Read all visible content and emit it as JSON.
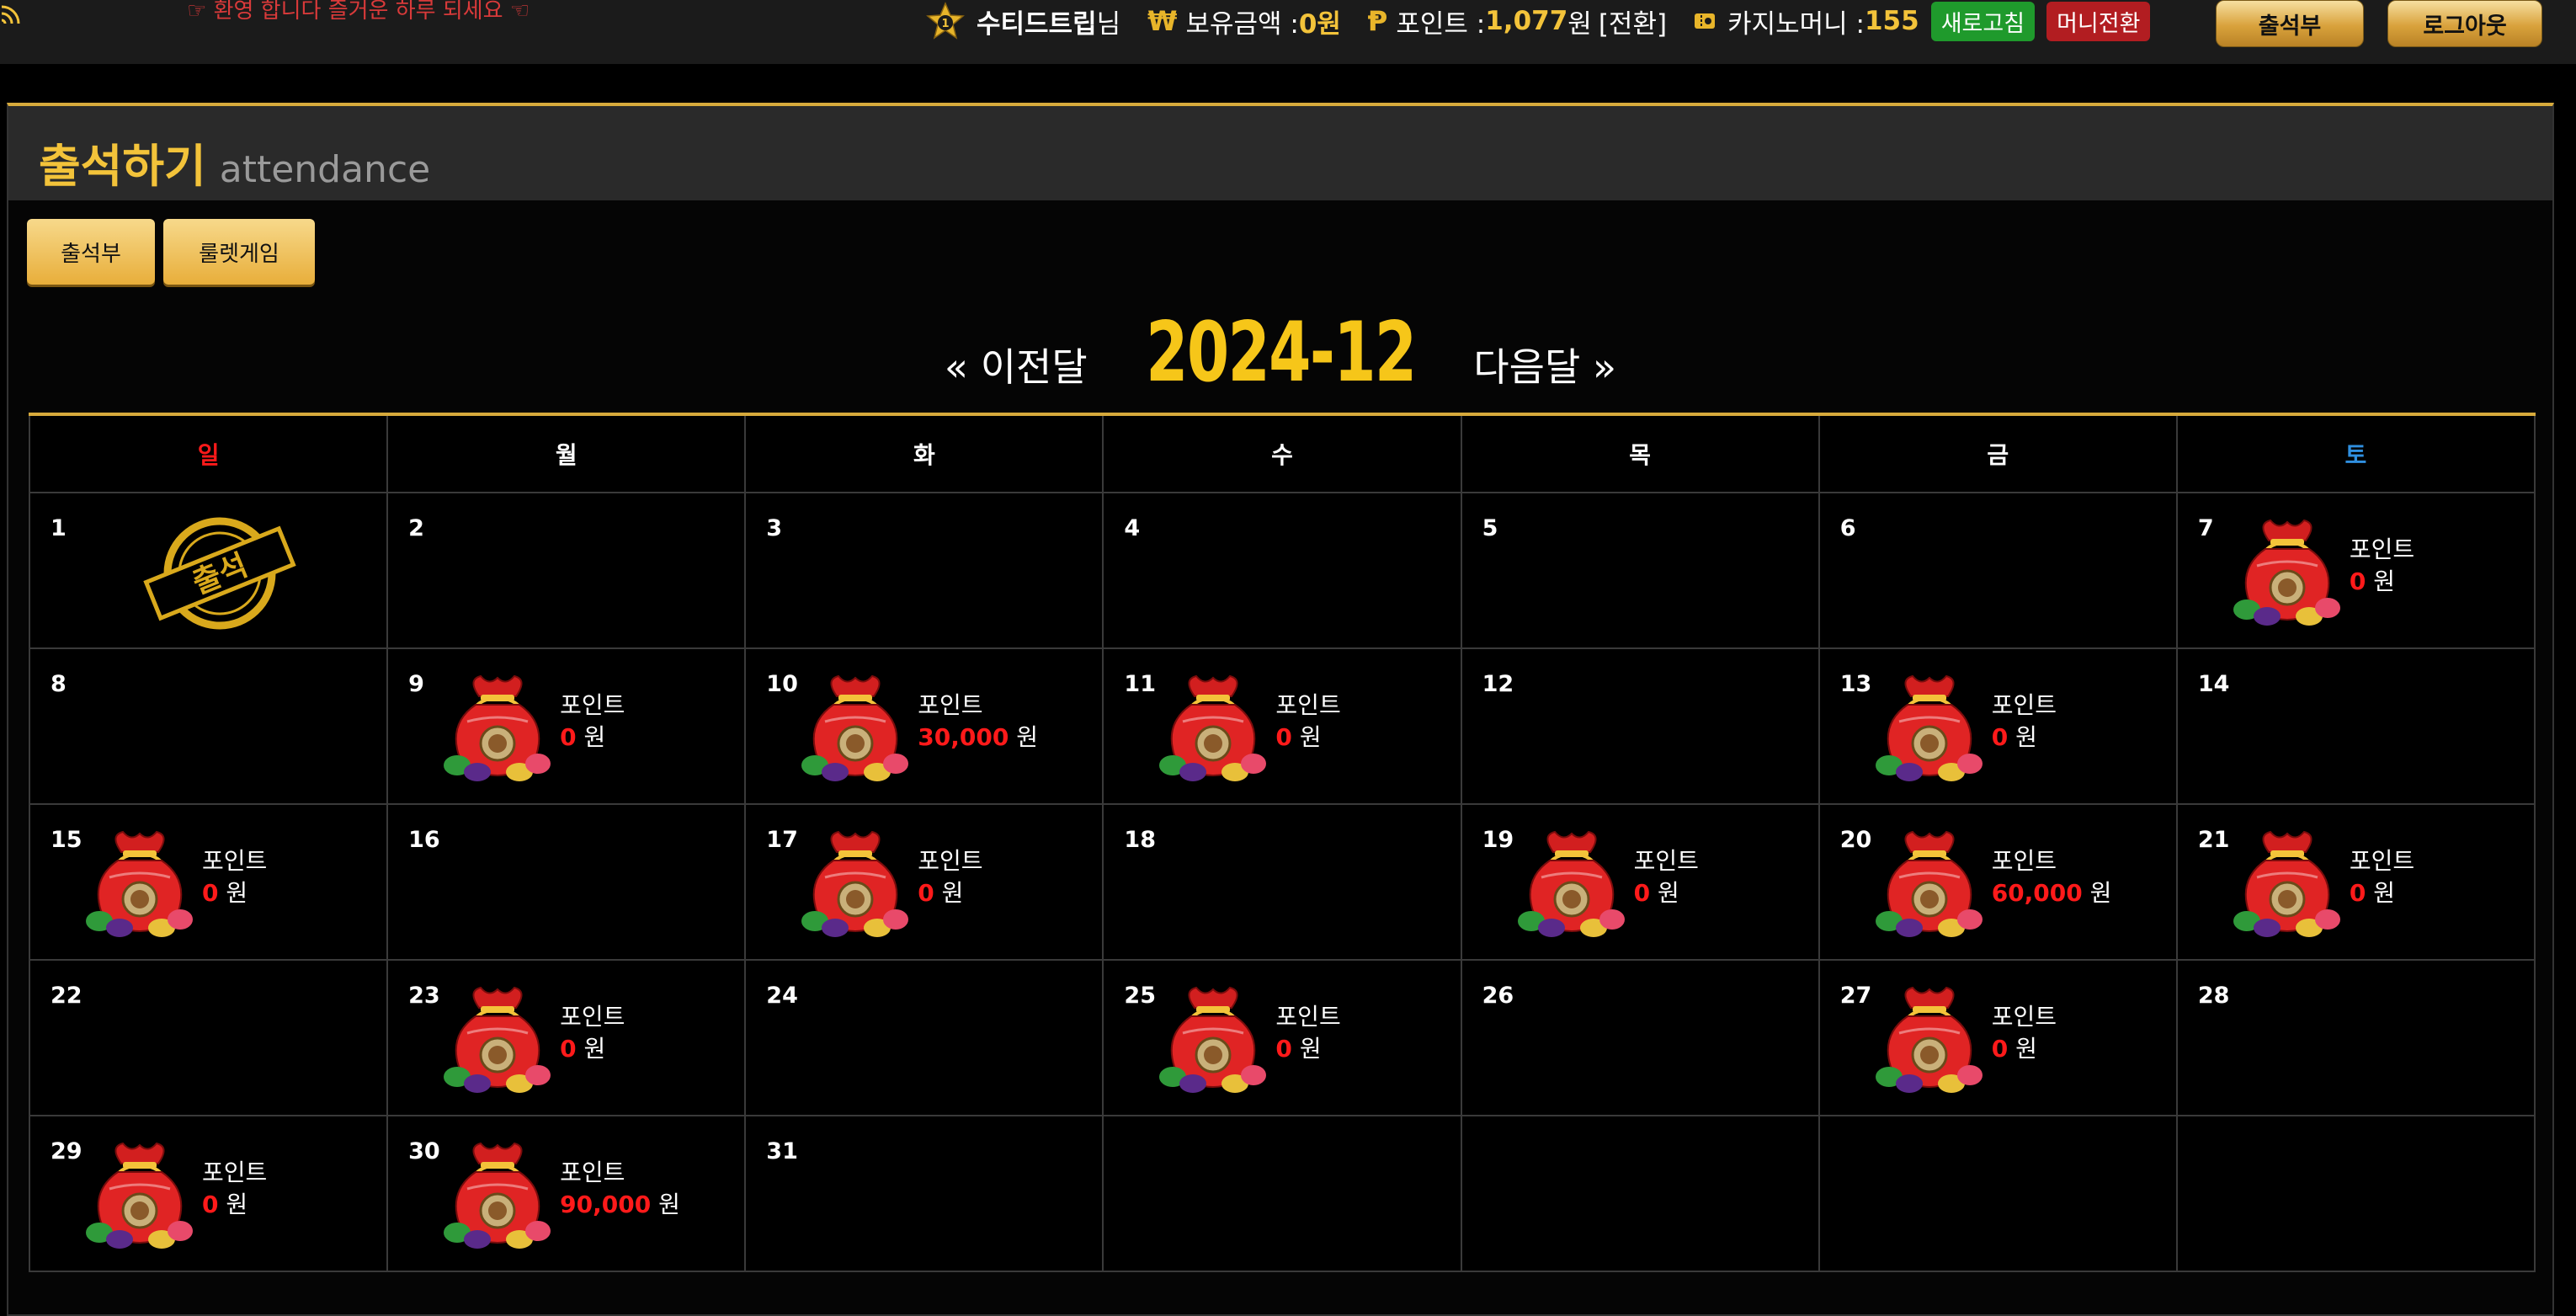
{
  "header": {
    "marquee": "☞ 환영 합니다 즐거운 하루 되세요 ☜",
    "rank_level": "1",
    "username": "수티드트립",
    "honorific": "님",
    "balance_label": "보유금액 : ",
    "balance_value": "0원",
    "points_label": "포인트 : ",
    "points_value": "1,077",
    "points_unit": "원",
    "convert_link": "[전환]",
    "casino_label": "카지노머니 : ",
    "casino_value": "155",
    "refresh_button": "새로고침",
    "money_convert_button": "머니전환",
    "attendance_button": "출석부",
    "logout_button": "로그아웃",
    "won_symbol": "₩",
    "point_symbol": "Ᵽ"
  },
  "panel": {
    "title": "출석하기",
    "subtitle": "attendance"
  },
  "tabs": [
    "출석부",
    "룰렛게임"
  ],
  "calendar": {
    "prev": "« 이전달",
    "month": "2024-12",
    "next": "다음달 »",
    "weekdays": [
      "일",
      "월",
      "화",
      "수",
      "목",
      "금",
      "토"
    ],
    "stamp_text": "출석",
    "reward_label": "포인트",
    "reward_unit": "원",
    "days": [
      {
        "day": "1",
        "stamp": true
      },
      {
        "day": "2"
      },
      {
        "day": "3"
      },
      {
        "day": "4"
      },
      {
        "day": "5"
      },
      {
        "day": "6"
      },
      {
        "day": "7",
        "points": "0"
      },
      {
        "day": "8"
      },
      {
        "day": "9",
        "points": "0"
      },
      {
        "day": "10",
        "points": "30,000"
      },
      {
        "day": "11",
        "points": "0"
      },
      {
        "day": "12"
      },
      {
        "day": "13",
        "points": "0"
      },
      {
        "day": "14"
      },
      {
        "day": "15",
        "points": "0"
      },
      {
        "day": "16"
      },
      {
        "day": "17",
        "points": "0"
      },
      {
        "day": "18"
      },
      {
        "day": "19",
        "points": "0"
      },
      {
        "day": "20",
        "points": "60,000"
      },
      {
        "day": "21",
        "points": "0"
      },
      {
        "day": "22"
      },
      {
        "day": "23",
        "points": "0"
      },
      {
        "day": "24"
      },
      {
        "day": "25",
        "points": "0"
      },
      {
        "day": "26"
      },
      {
        "day": "27",
        "points": "0"
      },
      {
        "day": "28"
      },
      {
        "day": "29",
        "points": "0"
      },
      {
        "day": "30",
        "points": "90,000"
      },
      {
        "day": "31"
      }
    ]
  },
  "colors": {
    "accent_gold": "#f3c33a",
    "sunday": "#ff1a1a",
    "saturday": "#2f8fe0",
    "points_red": "#ff1a1a"
  }
}
